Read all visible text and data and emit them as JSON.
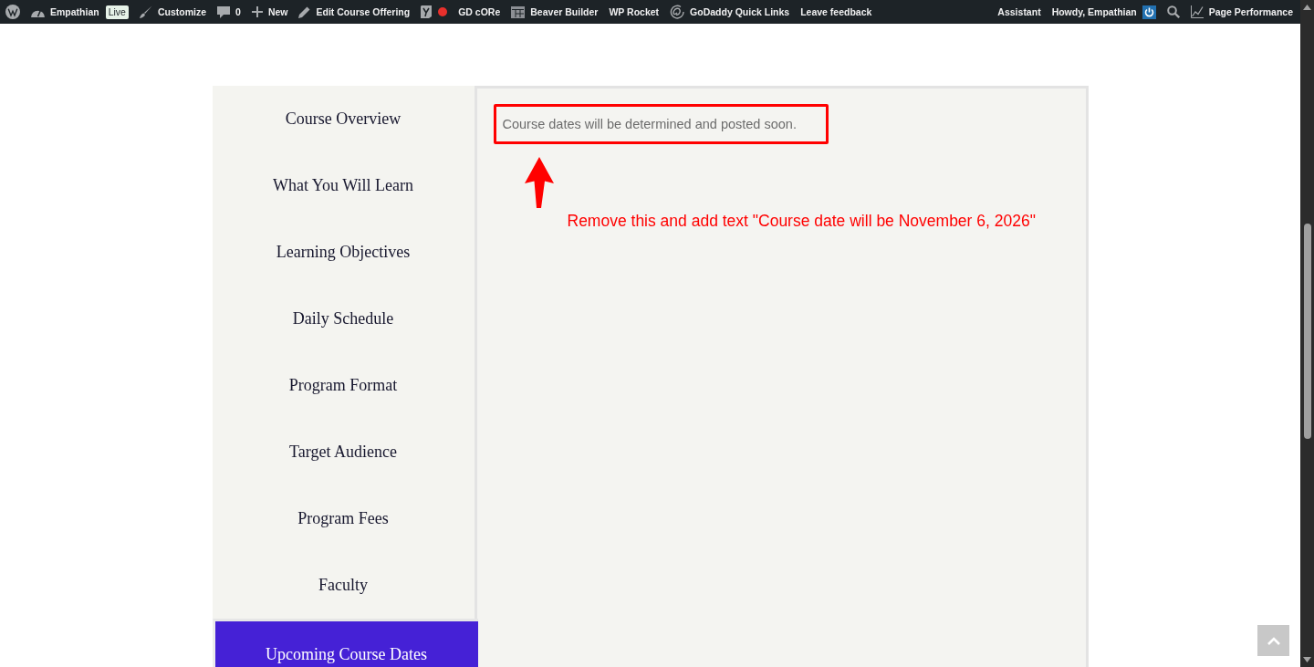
{
  "admin_bar": {
    "left": [
      {
        "kind": "logo"
      },
      {
        "kind": "site",
        "label": "Empathian",
        "badge": "Live"
      },
      {
        "kind": "customize",
        "label": "Customize"
      },
      {
        "kind": "comments",
        "label": "0"
      },
      {
        "kind": "new",
        "label": "New"
      },
      {
        "kind": "edit",
        "label": "Edit Course Offering"
      },
      {
        "kind": "seo"
      },
      {
        "kind": "text",
        "label": "GD cORe"
      },
      {
        "kind": "builder",
        "label": "Beaver Builder"
      },
      {
        "kind": "text",
        "label": "WP Rocket"
      },
      {
        "kind": "quick_links",
        "label": "GoDaddy Quick Links"
      },
      {
        "kind": "text",
        "label": "Leave feedback"
      }
    ],
    "right": [
      {
        "kind": "text",
        "label": "Assistant"
      },
      {
        "kind": "account",
        "label": "Howdy, Empathian"
      },
      {
        "kind": "search"
      },
      {
        "kind": "performance",
        "label": "Page Performance"
      }
    ]
  },
  "tabs": [
    {
      "label": "Course Overview",
      "selected": false
    },
    {
      "label": "What You Will Learn",
      "selected": false
    },
    {
      "label": "Learning Objectives",
      "selected": false
    },
    {
      "label": "Daily Schedule",
      "selected": false
    },
    {
      "label": "Program Format",
      "selected": false
    },
    {
      "label": "Target Audience",
      "selected": false
    },
    {
      "label": "Program Fees",
      "selected": false
    },
    {
      "label": "Faculty",
      "selected": false
    },
    {
      "label": "Upcoming Course Dates",
      "selected": true
    }
  ],
  "panel": {
    "text": "Course dates will be determined and posted soon."
  },
  "annotation": {
    "note": "Remove this and add text \"Course date will be November 6, 2026\""
  }
}
